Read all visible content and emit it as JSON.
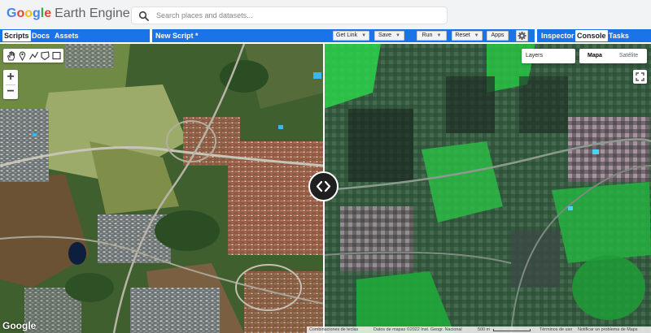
{
  "header": {
    "logo_letters": [
      {
        "ch": "G",
        "color": "#4285f4"
      },
      {
        "ch": "o",
        "color": "#ea4335"
      },
      {
        "ch": "o",
        "color": "#fbbc05"
      },
      {
        "ch": "g",
        "color": "#4285f4"
      },
      {
        "ch": "l",
        "color": "#34a853"
      },
      {
        "ch": "e",
        "color": "#ea4335"
      }
    ],
    "product": "Earth Engine",
    "search_placeholder": "Search places and datasets...",
    "search_icon": "search-icon"
  },
  "left_tabs": [
    {
      "label": "Scripts",
      "active": true
    },
    {
      "label": "Docs",
      "active": false
    },
    {
      "label": "Assets",
      "active": false
    }
  ],
  "editor": {
    "script_title": "New Script *",
    "buttons": [
      {
        "label": "Get Link",
        "dropdown": true
      },
      {
        "label": "Save",
        "dropdown": true
      },
      {
        "label": "Run",
        "dropdown": true
      },
      {
        "label": "Reset",
        "dropdown": true
      },
      {
        "label": "Apps",
        "dropdown": false
      }
    ],
    "settings_icon": "gear-icon"
  },
  "right_tabs": [
    {
      "label": "Inspector",
      "active": false
    },
    {
      "label": "Console",
      "active": true
    },
    {
      "label": "Tasks",
      "active": false
    }
  ],
  "map": {
    "draw_tools": [
      "hand-icon",
      "marker-icon",
      "line-icon",
      "polygon-icon",
      "rectangle-icon"
    ],
    "zoom_in": "+",
    "zoom_out": "−",
    "layers_label": "Layers",
    "map_types": [
      {
        "label": "Mapa",
        "active": true
      },
      {
        "label": "Satélite",
        "active": false
      }
    ],
    "fullscreen_icon": "fullscreen-icon",
    "swipe_icon": "swipe-arrows-icon",
    "watermark": "Google",
    "footer": {
      "shortcuts": "Combinaciones de teclas",
      "map_data": "Datos de mapas ©2022 Inst. Geogr. Nacional",
      "scale": "500 m",
      "terms": "Términos de uso",
      "report": "Notificar un problema de Maps"
    }
  },
  "colors": {
    "accent": "#1a73e8",
    "header_bg": "#f1f3f4",
    "toolbar_button_bg": "#f1f3f4",
    "vegetation_left": "#2f5a27",
    "vegetation_right": "#22b83a",
    "urban_roofs": "#a0573f"
  }
}
